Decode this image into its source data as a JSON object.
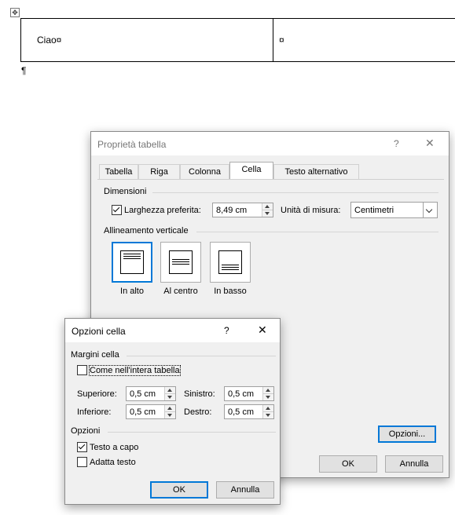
{
  "document": {
    "cell1_text": "Ciao¤",
    "cell2_text": "¤",
    "paragraph_mark": "¶"
  },
  "main_dialog": {
    "title": "Proprietà tabella",
    "help": "?",
    "close": "✕",
    "tabs": [
      {
        "label": "Tabella",
        "active": false
      },
      {
        "label": "Riga",
        "active": false
      },
      {
        "label": "Colonna",
        "active": false
      },
      {
        "label": "Cella",
        "active": true
      },
      {
        "label": "Testo alternativo",
        "active": false
      }
    ],
    "size_group": "Dimensioni",
    "preferred_width_label": "Larghezza preferita:",
    "preferred_width_checked": true,
    "preferred_width_value": "8,49 cm",
    "unit_label": "Unità di misura:",
    "unit_value": "Centimetri",
    "vertical_align_group": "Allineamento verticale",
    "align_options": [
      {
        "label": "In alto",
        "selected": true
      },
      {
        "label": "Al centro",
        "selected": false
      },
      {
        "label": "In basso",
        "selected": false
      }
    ],
    "options_button": "Opzioni...",
    "ok_button": "OK",
    "cancel_button": "Annulla"
  },
  "options_dialog": {
    "title": "Opzioni cella",
    "help": "?",
    "close": "✕",
    "margins_group": "Margini cella",
    "same_as_table_label": "Come nell'intera tabella",
    "same_as_table_checked": false,
    "top_label": "Superiore:",
    "top_value": "0,5 cm",
    "left_label": "Sinistro:",
    "left_value": "0,5 cm",
    "bottom_label": "Inferiore:",
    "bottom_value": "0,5 cm",
    "right_label": "Destro:",
    "right_value": "0,5 cm",
    "options_group": "Opzioni",
    "wrap_text_label": "Testo a capo",
    "wrap_text_checked": true,
    "fit_text_label": "Adatta testo",
    "fit_text_checked": false,
    "ok_button": "OK",
    "cancel_button": "Annulla"
  }
}
